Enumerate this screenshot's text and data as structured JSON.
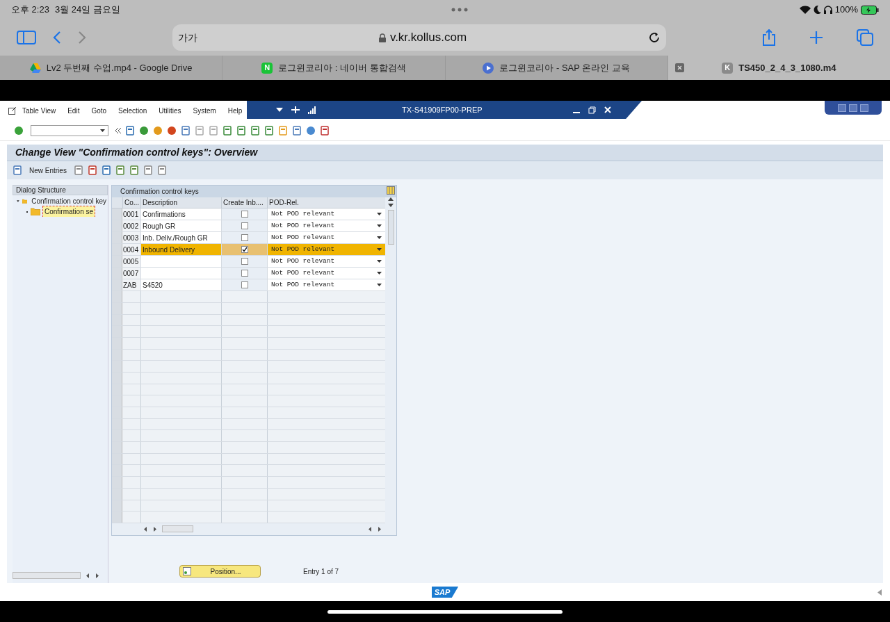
{
  "status_bar": {
    "time": "오후 2:23",
    "date": "3월 24일 금요일",
    "battery": "100%"
  },
  "browser": {
    "text_size_button": "가가",
    "url": "v.kr.kollus.com",
    "tabs": [
      {
        "title": "Lv2 두번째 수업.mp4 - Google Drive",
        "kind": "drive",
        "selected": false
      },
      {
        "title": "로그윈코리아 : 네이버 통합검색",
        "kind": "naver",
        "icon_text": "N",
        "selected": false
      },
      {
        "title": "로그윈코리아 - SAP 온라인 교육",
        "kind": "play",
        "selected": false
      },
      {
        "title": "TS450_2_4_3_1080.m4",
        "kind": "letter",
        "icon_text": "K",
        "selected": true
      }
    ]
  },
  "sap": {
    "menu": [
      "Table View",
      "Edit",
      "Goto",
      "Selection",
      "Utilities",
      "System",
      "Help"
    ],
    "system_title": "TX-S41909FP00-PREP",
    "screen_title": "Change View \"Confirmation control keys\": Overview",
    "new_entries": "New Entries",
    "dialog_structure": {
      "title": "Dialog Structure",
      "items": [
        {
          "label": "Confirmation control key",
          "expanded": true,
          "selected": false,
          "children": [
            {
              "label": "Confirmation se",
              "selected": true
            }
          ]
        }
      ]
    },
    "table": {
      "title": "Confirmation control keys",
      "columns": [
        "Co...",
        "Description",
        "Create Inb....",
        "POD-Rel."
      ],
      "rows": [
        {
          "code": "0001",
          "description": "Confirmations",
          "create_inbound": false,
          "pod_rel": "Not POD relevant",
          "selected": false
        },
        {
          "code": "0002",
          "description": "Rough GR",
          "create_inbound": false,
          "pod_rel": "Not POD relevant",
          "selected": false
        },
        {
          "code": "0003",
          "description": "Inb. Deliv./Rough GR",
          "create_inbound": false,
          "pod_rel": "Not POD relevant",
          "selected": false
        },
        {
          "code": "0004",
          "description": "Inbound Delivery",
          "create_inbound": true,
          "pod_rel": "Not POD relevant",
          "selected": true
        },
        {
          "code": "0005",
          "create_inbound": false,
          "pod_rel": "Not POD relevant",
          "selected": false
        },
        {
          "code": "0007",
          "create_inbound": false,
          "pod_rel": "Not POD relevant",
          "selected": false
        },
        {
          "code": "ZAB",
          "description": "S4520",
          "create_inbound": false,
          "pod_rel": "Not POD relevant",
          "selected": false
        }
      ]
    },
    "position_button": "Position...",
    "entry_info": "Entry 1 of 7",
    "logo": "SAP"
  }
}
